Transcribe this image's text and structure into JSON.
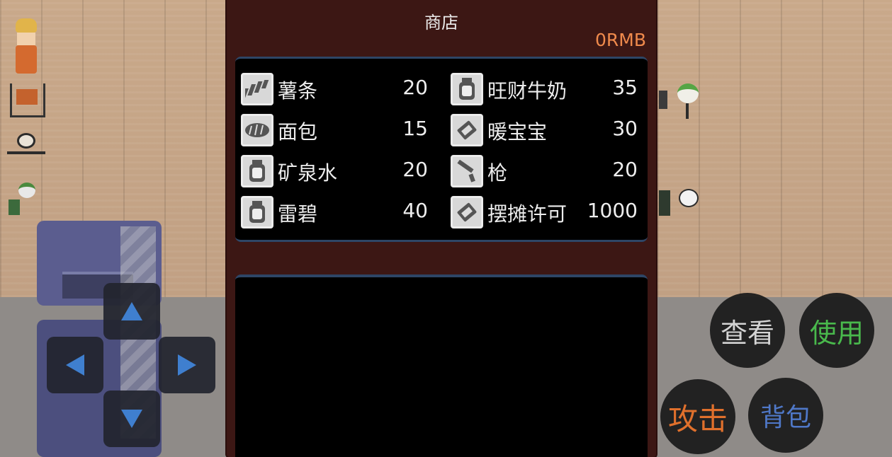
{
  "shop": {
    "title": "商店",
    "money": "0RMB",
    "items": [
      {
        "name": "薯条",
        "price": "20",
        "icon": "fries-icon"
      },
      {
        "name": "旺财牛奶",
        "price": "35",
        "icon": "bottle-icon"
      },
      {
        "name": "面包",
        "price": "15",
        "icon": "bread-icon"
      },
      {
        "name": "暖宝宝",
        "price": "30",
        "icon": "ticket-icon"
      },
      {
        "name": "矿泉水",
        "price": "20",
        "icon": "bottle-icon"
      },
      {
        "name": "枪",
        "price": "20",
        "icon": "gun-icon"
      },
      {
        "name": "雷碧",
        "price": "40",
        "icon": "bottle-icon"
      },
      {
        "name": "摆摊许可",
        "price": "1000",
        "icon": "ticket-icon"
      }
    ],
    "description": ""
  },
  "controls": {
    "dpad": [
      "up-arrow-icon",
      "left-arrow-icon",
      "right-arrow-icon",
      "down-arrow-icon"
    ],
    "view_label": "查看",
    "use_label": "使用",
    "attack_label": "攻击",
    "bag_label": "背包"
  },
  "colors": {
    "panel": "#3c1714",
    "money": "#ef8a4c",
    "use": "#49b94c",
    "attack": "#e0702c",
    "bag": "#4f78c8",
    "dpad_arrow": "#3f7fcf"
  }
}
